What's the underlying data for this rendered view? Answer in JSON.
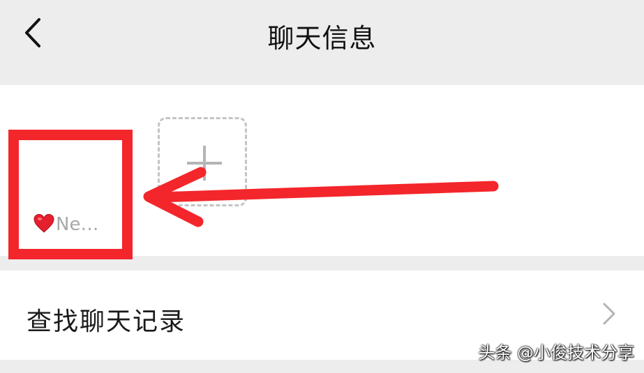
{
  "header": {
    "title": "聊天信息"
  },
  "members": [
    {
      "name": "Ne…",
      "avatar_emoji": "heart-icon"
    }
  ],
  "add_member": {
    "icon": "plus-icon"
  },
  "search_history": {
    "label": "查找聊天记录",
    "icon": "chevron-right-icon"
  },
  "annotation": {
    "color": "#f3262b"
  },
  "watermark": {
    "text": "头条 @小俊技术分享"
  }
}
